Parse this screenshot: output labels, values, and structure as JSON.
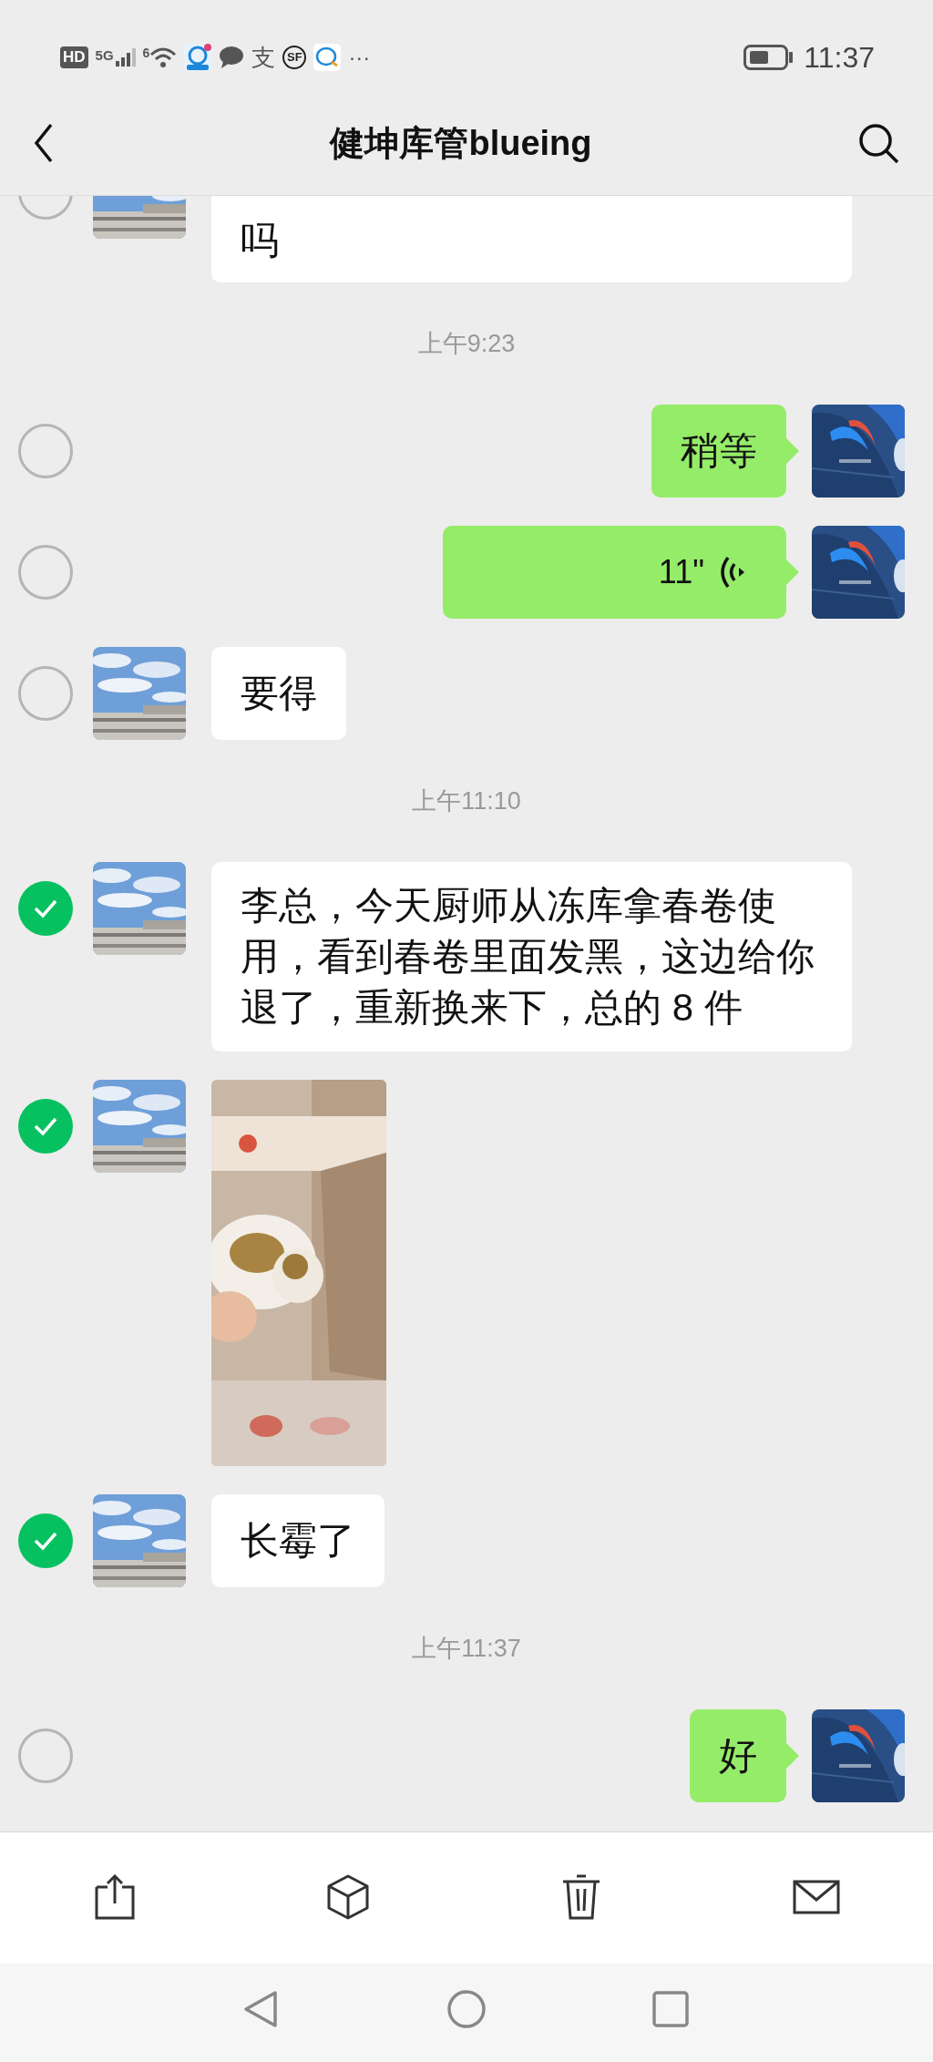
{
  "status_bar": {
    "network_labels": [
      "HD",
      "5G",
      "6"
    ],
    "notification_texts": [
      "支",
      "SF"
    ],
    "more": "···",
    "time": "11:37"
  },
  "header": {
    "title": "健坤库管blueing"
  },
  "messages": [
    {
      "kind": "incoming_text",
      "text": "吗",
      "selected": false,
      "clipped_top": true
    },
    {
      "kind": "time",
      "text": "上午9:23"
    },
    {
      "kind": "outgoing_text",
      "text": "稍等",
      "selected": false
    },
    {
      "kind": "outgoing_voice",
      "text": "11\"",
      "selected": false
    },
    {
      "kind": "incoming_text",
      "text": "要得",
      "selected": false
    },
    {
      "kind": "time",
      "text": "上午11:10"
    },
    {
      "kind": "incoming_text",
      "text": "李总，今天厨师从冻库拿春卷使用，看到春卷里面发黑，这边给你退了，重新换来下，总的 8 件",
      "selected": true
    },
    {
      "kind": "incoming_image",
      "selected": true
    },
    {
      "kind": "incoming_text",
      "text": "长霉了",
      "selected": true
    },
    {
      "kind": "time",
      "text": "上午11:37"
    },
    {
      "kind": "outgoing_text",
      "text": "好",
      "selected": false
    }
  ]
}
